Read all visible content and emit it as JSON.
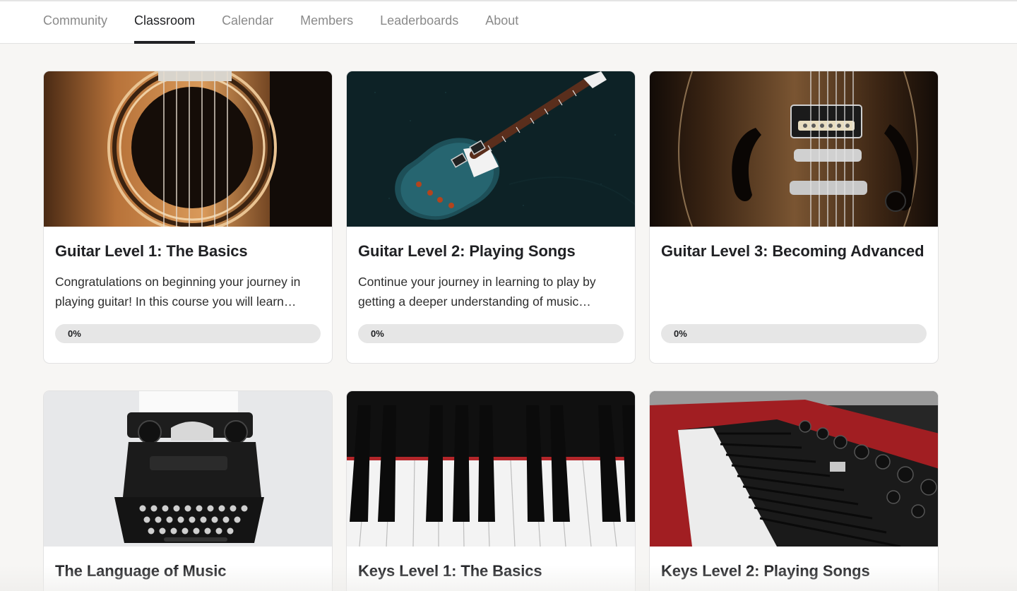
{
  "nav": {
    "tabs": [
      {
        "label": "Community",
        "active": false
      },
      {
        "label": "Classroom",
        "active": true
      },
      {
        "label": "Calendar",
        "active": false
      },
      {
        "label": "Members",
        "active": false
      },
      {
        "label": "Leaderboards",
        "active": false
      },
      {
        "label": "About",
        "active": false
      }
    ]
  },
  "courses": [
    {
      "title": "Guitar Level 1: The Basics",
      "description": "Congratulations on beginning your journey in playing guitar! In this course you will learn…",
      "progress": 0,
      "progress_label": "0%",
      "image": "acoustic-guitar-soundhole-image"
    },
    {
      "title": "Guitar Level 2: Playing Songs",
      "description": "Continue your journey in learning to play by getting a deeper understanding of music…",
      "progress": 0,
      "progress_label": "0%",
      "image": "electric-guitar-on-dark-background-image"
    },
    {
      "title": "Guitar Level 3: Becoming Advanced",
      "description": "",
      "progress": 0,
      "progress_label": "0%",
      "image": "hollow-body-guitar-pickups-image"
    },
    {
      "title": "The Language of Music",
      "image": "vintage-typewriter-image"
    },
    {
      "title": "Keys Level 1: The Basics",
      "image": "piano-keys-image"
    },
    {
      "title": "Keys Level 2: Playing Songs",
      "image": "red-keyboard-synth-image"
    }
  ],
  "colors": {
    "background": "#f7f6f4",
    "card": "#ffffff",
    "text": "#202124",
    "muted_tab": "#8a8a8a",
    "progress_track": "#e6e6e6"
  }
}
